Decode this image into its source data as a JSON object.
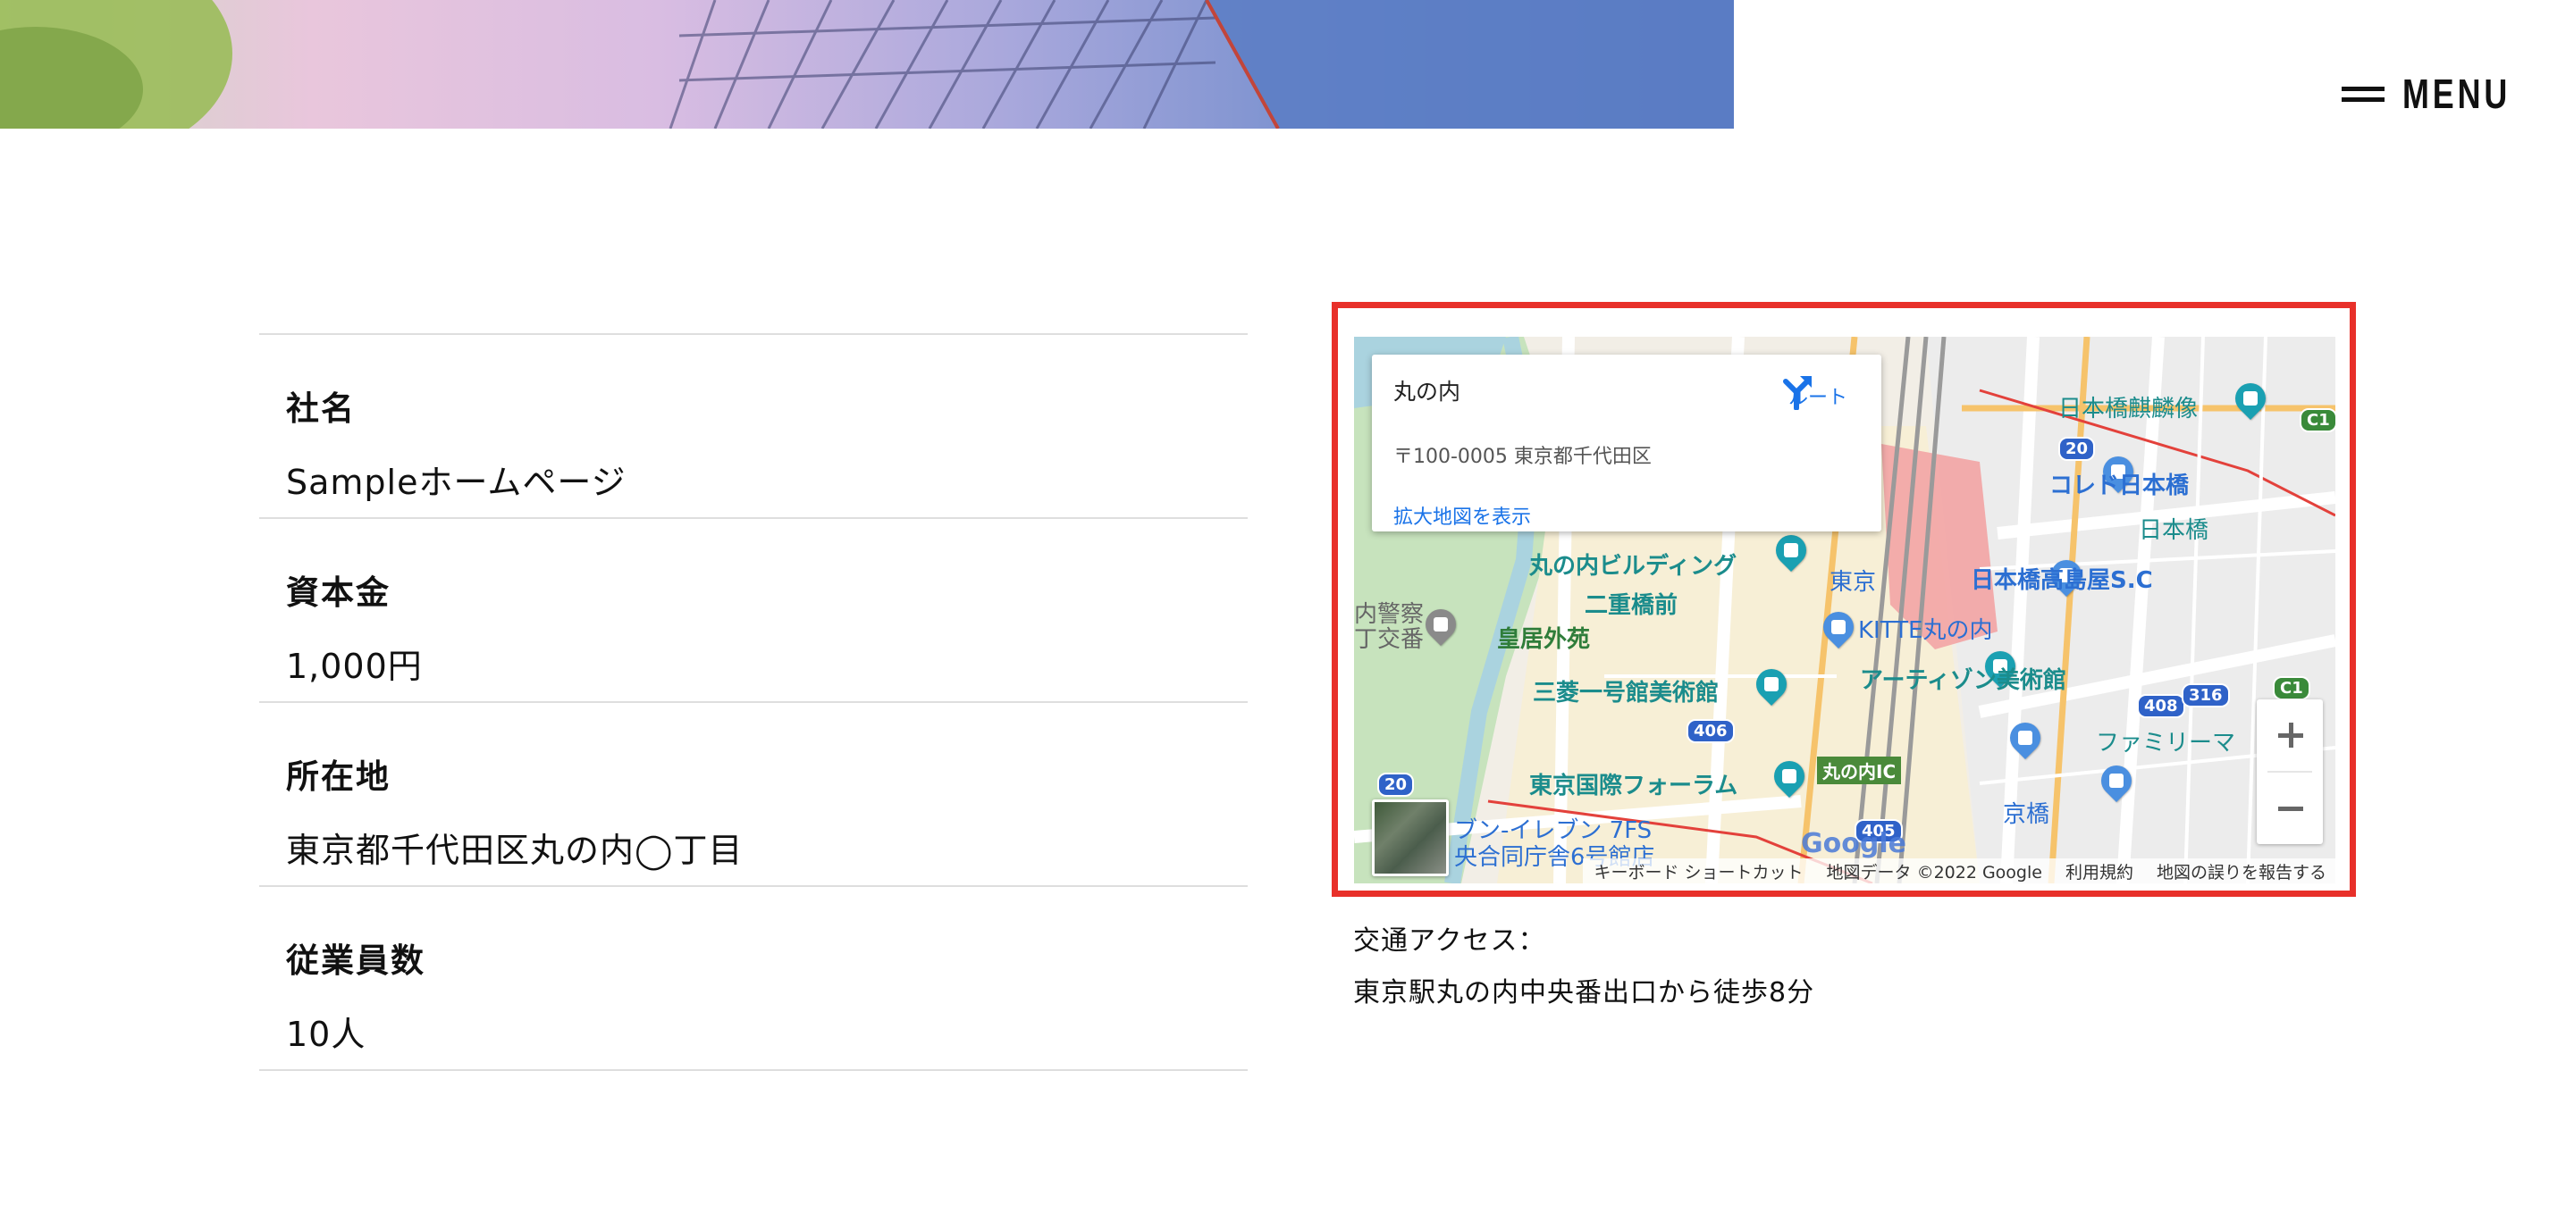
{
  "header": {
    "menu_label": "MENU"
  },
  "company_info": {
    "rows": [
      {
        "label": "社名",
        "value": "Sampleホームページ"
      },
      {
        "label": "資本金",
        "value": "1,000円"
      },
      {
        "label": "所在地",
        "value": "東京都千代田区丸の内◯丁目"
      },
      {
        "label": "従業員数",
        "value": "10人"
      }
    ]
  },
  "map": {
    "popup": {
      "title": "丸の内",
      "address": "〒100-0005 東京都千代田区",
      "route_label": "ルート",
      "larger_map_link": "拡大地図を表示"
    },
    "labels": {
      "marunouchi_building": "丸の内ビルディング",
      "nijubashimae": "二重橋前",
      "kokyo_gaien": "皇居外苑",
      "mitsubishi_museum": "三菱一号館美術館",
      "tokyo_forum": "東京国際フォーラム",
      "seven_eleven": "ブン-イレブン 7FS",
      "gov_building": "央合同庁舎6号館店",
      "keisatsu_1": "内警察",
      "keisatsu_2": "丁交番",
      "nihonbashi_kirin": "日本橋麒麟像",
      "coredo": "コレド日本橋",
      "nihonbashi": "日本橋",
      "tokyo": "東京",
      "takashimaya": "日本橋高島屋S.C",
      "kitte": "KITTE丸の内",
      "artizon": "アーティゾン美術館",
      "familymart": "ファミリーマ",
      "kyobashi": "京橋",
      "marunouchi_ic": "丸の内IC",
      "google": "Google"
    },
    "route_shields": [
      "20",
      "406",
      "408",
      "316",
      "C1",
      "C1",
      "20",
      "405"
    ],
    "attribution": {
      "shortcuts": "キーボード ショートカット",
      "data": "地図データ ©2022 Google",
      "terms": "利用規約",
      "report": "地図の誤りを報告する"
    },
    "colors": {
      "frame": "#e8302a",
      "link": "#1a73e8"
    }
  },
  "access": {
    "line1": "交通アクセス：",
    "line2": "東京駅丸の内中央番出口から徒歩8分"
  }
}
